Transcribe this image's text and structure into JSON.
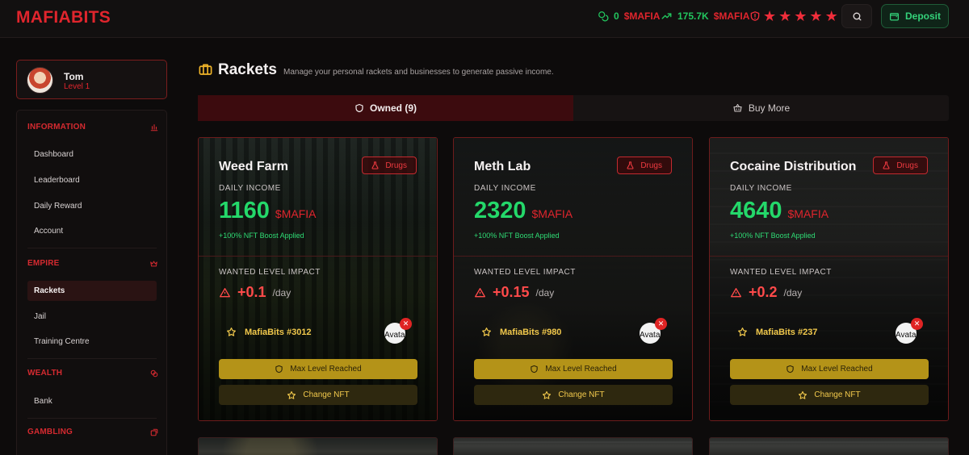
{
  "header": {
    "logo": "MAFIABITS",
    "balance_value": "0",
    "balance_currency": "$MAFIA",
    "trend_value": "175.7K",
    "trend_currency": "$MAFIA",
    "stars": 5,
    "deposit_label": "Deposit"
  },
  "user": {
    "name": "Tom",
    "level": "Level 1"
  },
  "sidebar": {
    "information": {
      "title": "INFORMATION",
      "items": [
        "Dashboard",
        "Leaderboard",
        "Daily Reward",
        "Account"
      ]
    },
    "empire": {
      "title": "EMPIRE",
      "items": [
        "Rackets",
        "Jail",
        "Training Centre"
      ],
      "active": "Rackets"
    },
    "wealth": {
      "title": "WEALTH",
      "items": [
        "Bank"
      ]
    },
    "gambling": {
      "title": "GAMBLING"
    }
  },
  "page": {
    "title": "Rackets",
    "subtitle": "Manage your personal rackets and businesses to generate passive income."
  },
  "tabs": {
    "owned": "Owned (9)",
    "buy": "Buy More"
  },
  "card_labels": {
    "daily_income": "DAILY INCOME",
    "wanted": "WANTED LEVEL IMPACT",
    "per_day": "/day",
    "max_level": "Max Level Reached",
    "change_nft": "Change NFT",
    "nft_alt": "Avatar"
  },
  "cards": [
    {
      "title": "Weed Farm",
      "category": "Drugs",
      "income": "1160",
      "currency": "$MAFIA",
      "boost": "+100% NFT Boost Applied",
      "wanted": "+0.1",
      "nft": "MafiaBits #3012"
    },
    {
      "title": "Meth Lab",
      "category": "Drugs",
      "income": "2320",
      "currency": "$MAFIA",
      "boost": "+100% NFT Boost Applied",
      "wanted": "+0.15",
      "nft": "MafiaBits #980"
    },
    {
      "title": "Cocaine Distribution",
      "category": "Drugs",
      "income": "4640",
      "currency": "$MAFIA",
      "boost": "+100% NFT Boost Applied",
      "wanted": "+0.2",
      "nft": "MafiaBits #237"
    }
  ],
  "colors": {
    "accent_red": "#e0252d",
    "income_green": "#24d86a",
    "gold": "#b49318"
  }
}
